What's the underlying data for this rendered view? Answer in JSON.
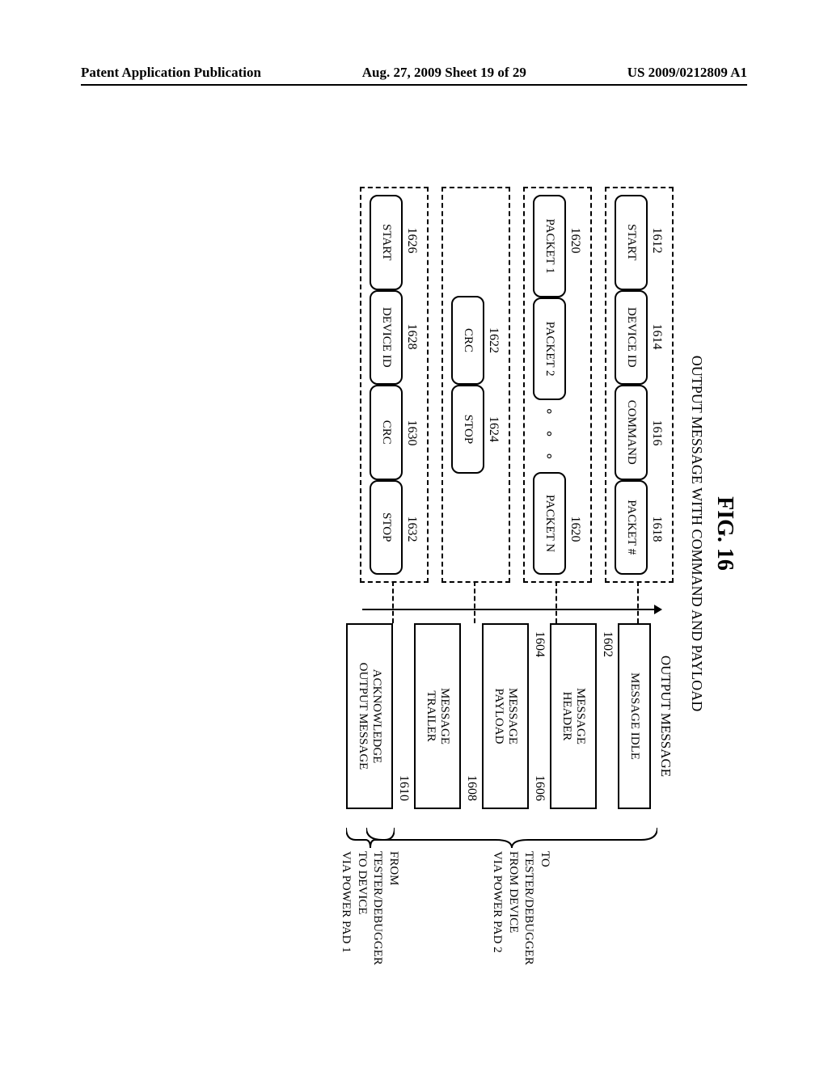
{
  "header": {
    "left": "Patent Application Publication",
    "center": "Aug. 27, 2009  Sheet 19 of 29",
    "right": "US 2009/0212809 A1"
  },
  "figure": {
    "title": "FIG. 16",
    "subtitle": "OUTPUT MESSAGE WITH COMMAND AND PAYLOAD"
  },
  "header_group": {
    "refs": [
      "1612",
      "1614",
      "1616",
      "1618"
    ],
    "cells": [
      "START",
      "DEVICE ID",
      "COMMAND",
      "PACKET #"
    ]
  },
  "payload_group": {
    "refs_top": [
      "1620",
      "",
      "",
      "1620"
    ],
    "cells": [
      "PACKET 1",
      "PACKET 2",
      "PACKET N"
    ],
    "dots": "∘  ∘  ∘"
  },
  "trailer_group": {
    "refs": [
      "1622",
      "1624"
    ],
    "cells": [
      "CRC",
      "STOP"
    ]
  },
  "ack_group": {
    "refs": [
      "1626",
      "1628",
      "1630",
      "1632"
    ],
    "cells": [
      "START",
      "DEVICE ID",
      "CRC",
      "STOP"
    ]
  },
  "right": {
    "title": "OUTPUT MESSAGE",
    "idle": "MESSAGE IDLE",
    "ref_idle": "1602",
    "header": "MESSAGE\nHEADER",
    "ref_header_l": "1604",
    "ref_header_r": "1606",
    "payload": "MESSAGE\nPAYLOAD",
    "ref_payload": "1608",
    "trailer": "MESSAGE\nTRAILER",
    "ref_trailer": "1610",
    "ack": "ACKNOWLEDGE\nOUTPUT MESSAGE"
  },
  "braces": {
    "top": "TO\nTESTER/DEBUGGER\nFROM DEVICE\nVIA POWER PAD 2",
    "bottom": "FROM\nTESTER/DEBUGGER\nTO DEVICE\nVIA POWER PAD 1"
  }
}
